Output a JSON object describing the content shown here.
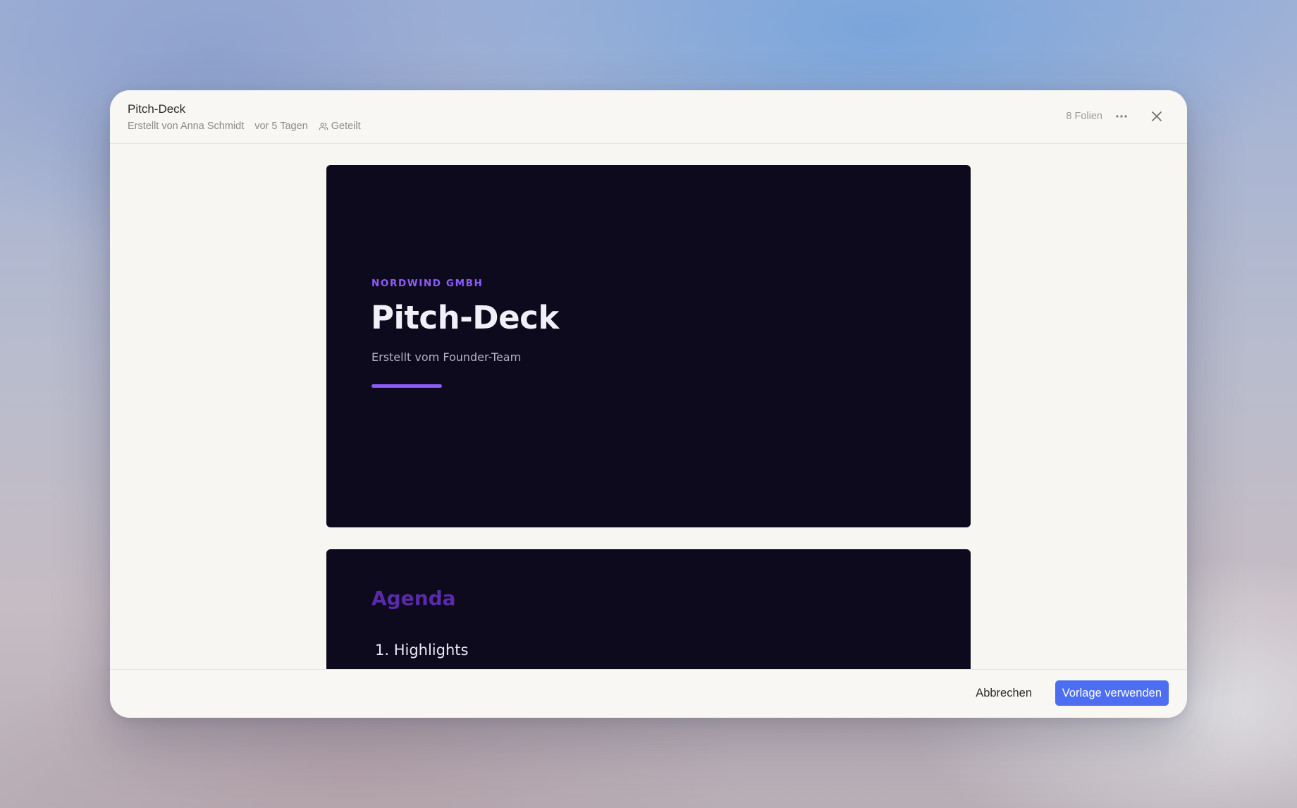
{
  "dialog": {
    "title": "Pitch-Deck",
    "meta": {
      "created_by": "Erstellt von Anna Schmidt",
      "created_ago": "vor 5 Tagen",
      "shared_label": "Geteilt",
      "shared_icon": "users-icon"
    },
    "slide_count": "8 Folien",
    "more_icon": "more-horizontal-icon",
    "close_icon": "close-icon"
  },
  "slides": [
    {
      "eyebrow": "NORDWIND GMBH",
      "title": "Pitch-Deck",
      "subtitle": "Erstellt vom Founder-Team",
      "background": "#0e0a1d",
      "accent": "#8b5cf6"
    },
    {
      "title": "Agenda",
      "items": [
        "1. Highlights"
      ],
      "background": "#0e0a1d",
      "title_color": "#5b2aa8"
    }
  ],
  "footer": {
    "cancel_label": "Abbrechen",
    "primary_label": "Vorlage verwenden",
    "primary_color": "#4e6ef2"
  }
}
